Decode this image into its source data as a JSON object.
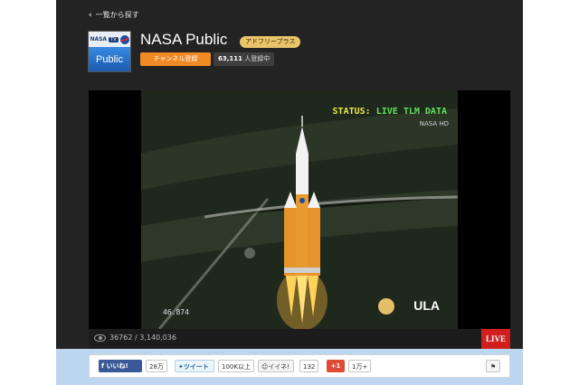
{
  "nav": {
    "back_label": "一覧から探す"
  },
  "channel": {
    "logo_brand": "NASA",
    "logo_tv": "TV",
    "logo_label": "Public",
    "title": "NASA Public",
    "badge": "アドフリープラス",
    "subscribe_label": "チャンネル登録",
    "subscriber_count": "63,111",
    "subscriber_suffix": "人登録中"
  },
  "video": {
    "status_prefix": "STATUS:",
    "status_value": "LIVE TLM DATA",
    "watermark": "NASA HD",
    "readout": "46.874",
    "overlay_logo": "ULA"
  },
  "stats": {
    "views": "36762 / 3,140,036",
    "live_label": "LIVE"
  },
  "share": {
    "facebook_label": "いいね!",
    "facebook_count": "28万",
    "twitter_label": "ツイート",
    "twitter_count": "100K以上",
    "mixi_label": "イイネ!",
    "mixi_count": "132",
    "gplus_label": "+1",
    "gplus_count": "1万+",
    "flag_label": "⚑"
  },
  "colors": {
    "accent_orange": "#f08a24",
    "live_red": "#d11f1f",
    "facebook": "#3b5998",
    "gplus": "#dd4b39"
  }
}
